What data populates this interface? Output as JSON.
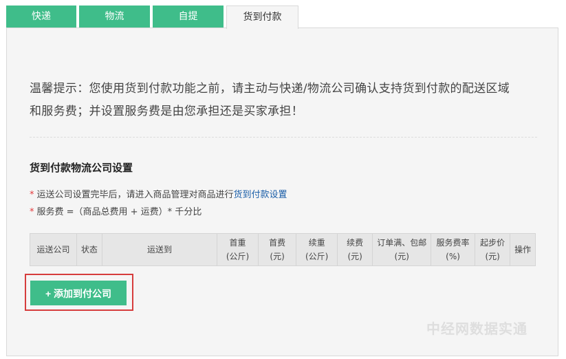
{
  "tabs": [
    {
      "label": "快递"
    },
    {
      "label": "物流"
    },
    {
      "label": "自提"
    },
    {
      "label": "货到付款"
    }
  ],
  "tip": {
    "line1": "温馨提示：您使用货到付款功能之前，请主动与快递/物流公司确认支持货到付款的配送区域",
    "line2": "和服务费；并设置服务费是由您承担还是买家承担！"
  },
  "section": {
    "title": "货到付款物流公司设置"
  },
  "notes": {
    "note1_prefix": "运送公司设置完毕后，请进入商品管理对商品进行",
    "note1_link": "货到付款设置",
    "note2": "服务费 =（商品总费用 + 运费）* 千分比",
    "star": "*"
  },
  "table": {
    "headers": [
      {
        "line1": "运送公司",
        "line2": ""
      },
      {
        "line1": "状态",
        "line2": ""
      },
      {
        "line1": "运送到",
        "line2": ""
      },
      {
        "line1": "首重",
        "line2": "(公斤)"
      },
      {
        "line1": "首费",
        "line2": "(元)"
      },
      {
        "line1": "续重",
        "line2": "(公斤)"
      },
      {
        "line1": "续费",
        "line2": "(元)"
      },
      {
        "line1": "订单满、包邮",
        "line2": "(元)"
      },
      {
        "line1": "服务费率",
        "line2": "(%)"
      },
      {
        "line1": "起步价",
        "line2": "(元)"
      },
      {
        "line1": "操作",
        "line2": ""
      }
    ]
  },
  "add_button": {
    "label": "+ 添加到付公司"
  },
  "watermark": {
    "text": "中经网数据实通"
  },
  "colors": {
    "accent": "#3fbd8a",
    "highlight": "#d63c3c",
    "link": "#1a5ea8"
  }
}
